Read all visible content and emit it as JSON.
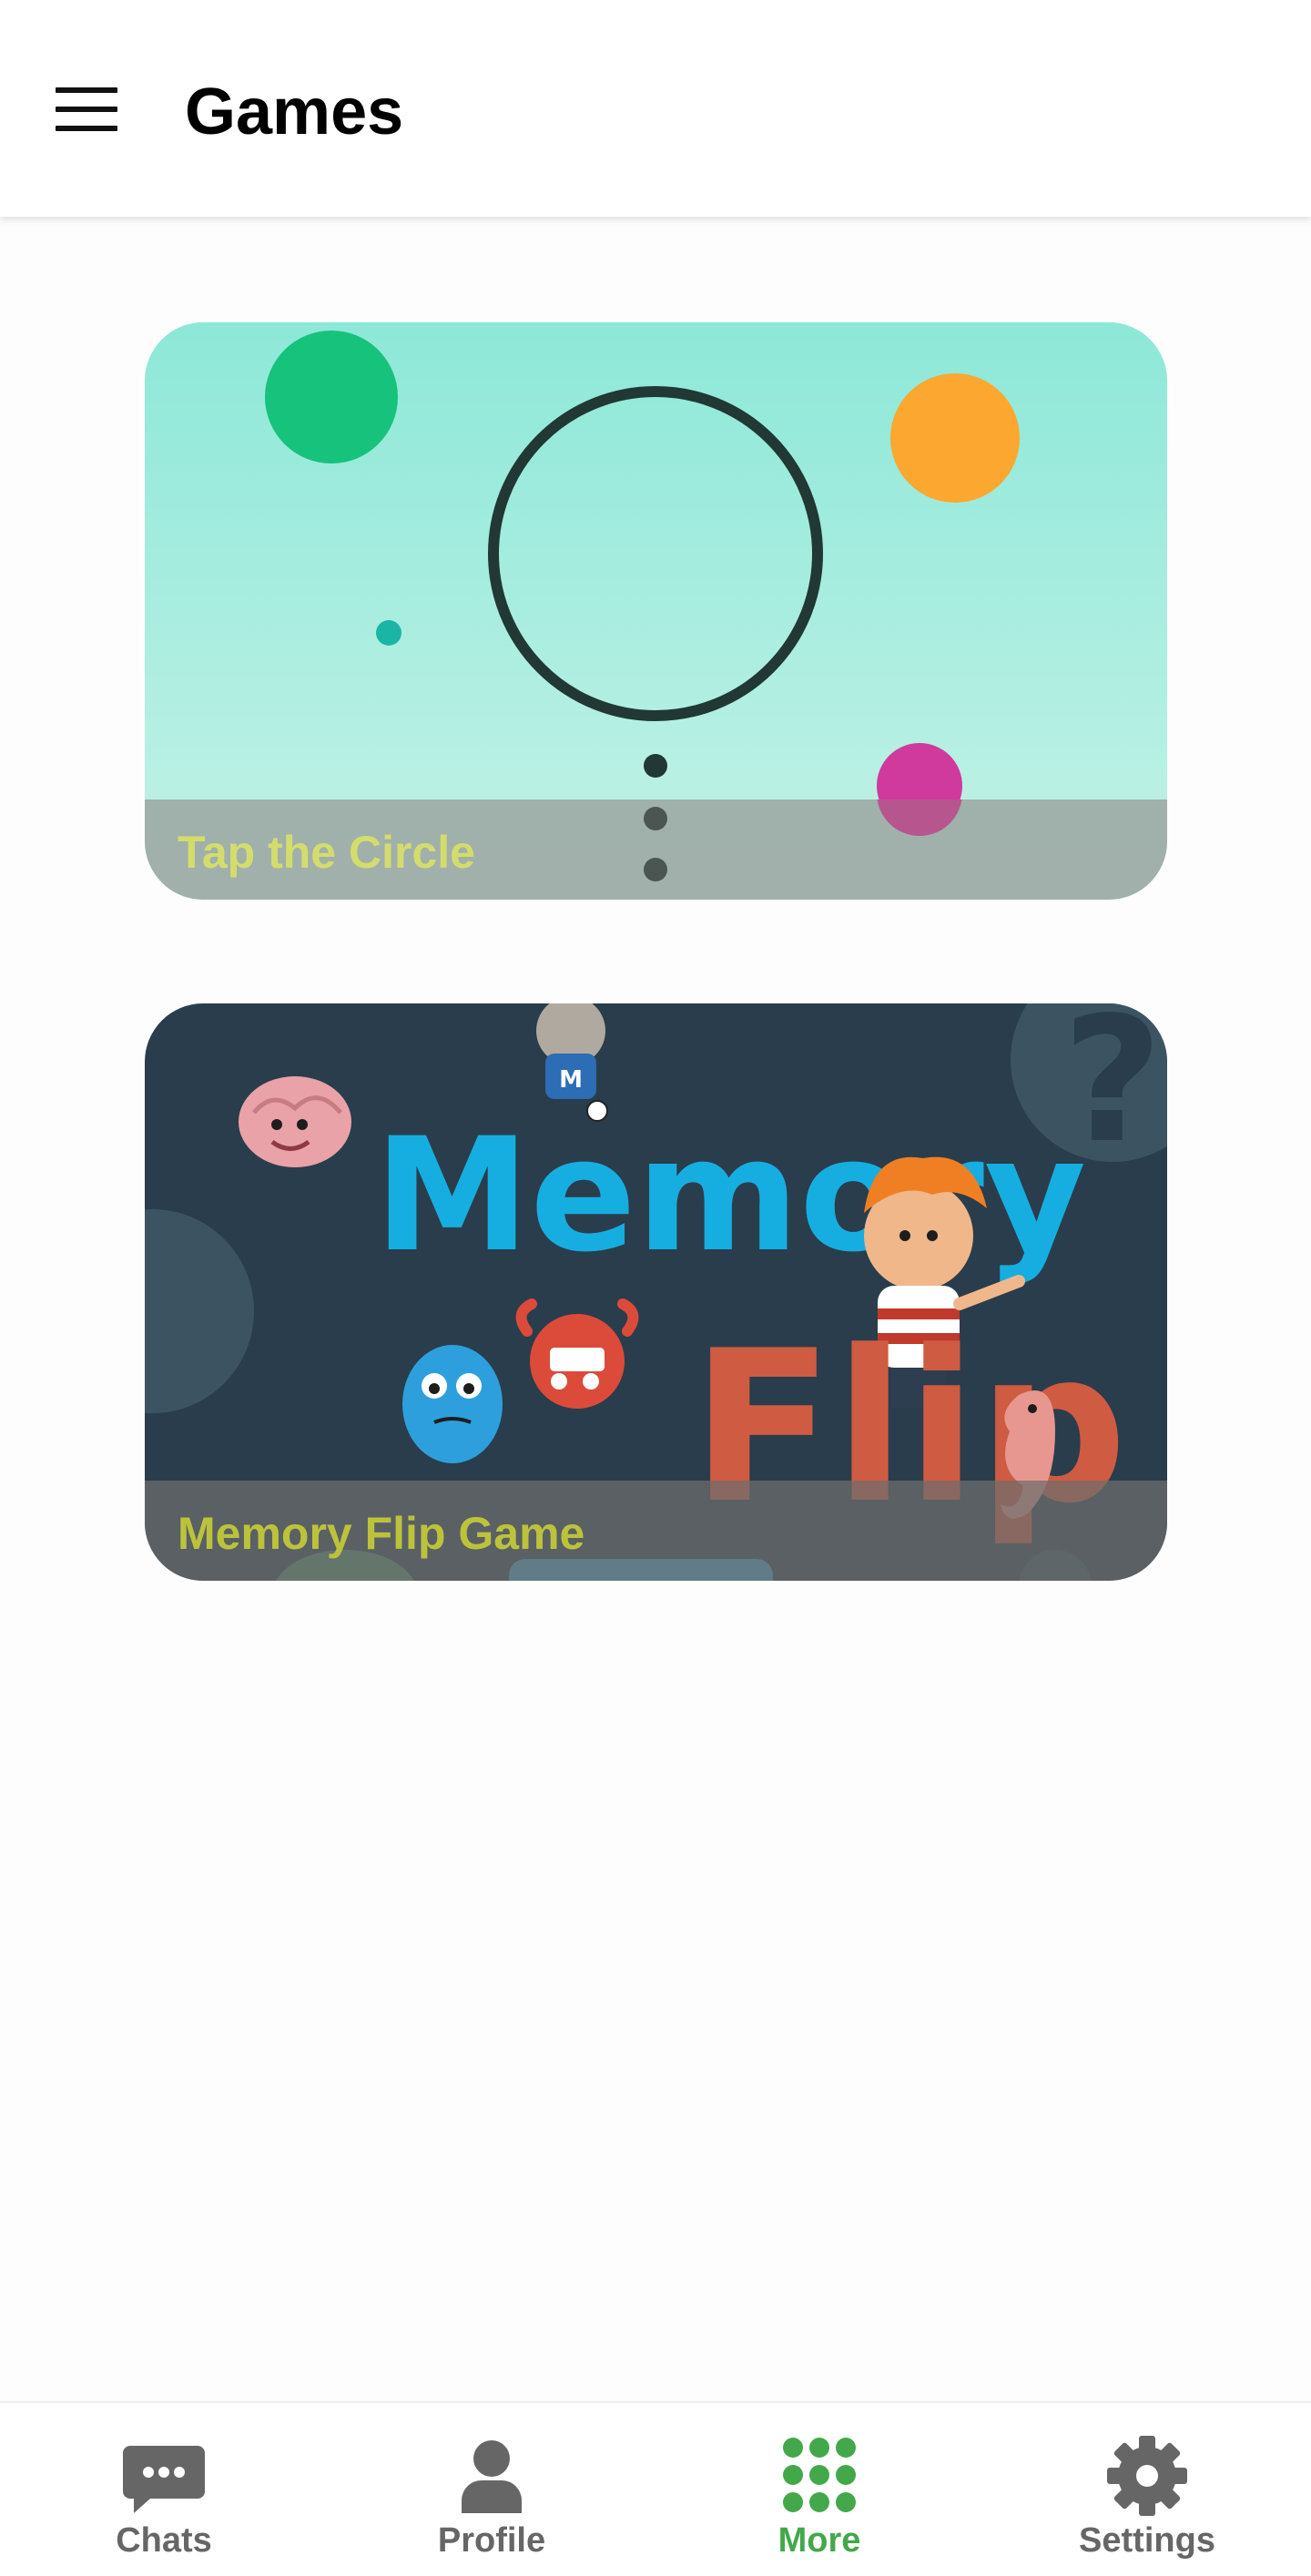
{
  "header": {
    "menu_icon": "hamburger-menu-icon",
    "title": "Games"
  },
  "games": [
    {
      "caption": "Tap the Circle"
    },
    {
      "caption": "Memory Flip Game"
    }
  ],
  "artwork_text": {
    "memory_word": "Memory",
    "flip_word": "Flip"
  },
  "bottom_nav": {
    "active": "More",
    "active_color": "#43a84a",
    "inactive_color": "#666666",
    "items": [
      {
        "label": "Chats",
        "icon": "chat-bubble-icon"
      },
      {
        "label": "Profile",
        "icon": "person-icon"
      },
      {
        "label": "More",
        "icon": "grid-dots-icon"
      },
      {
        "label": "Settings",
        "icon": "gear-icon"
      }
    ]
  }
}
